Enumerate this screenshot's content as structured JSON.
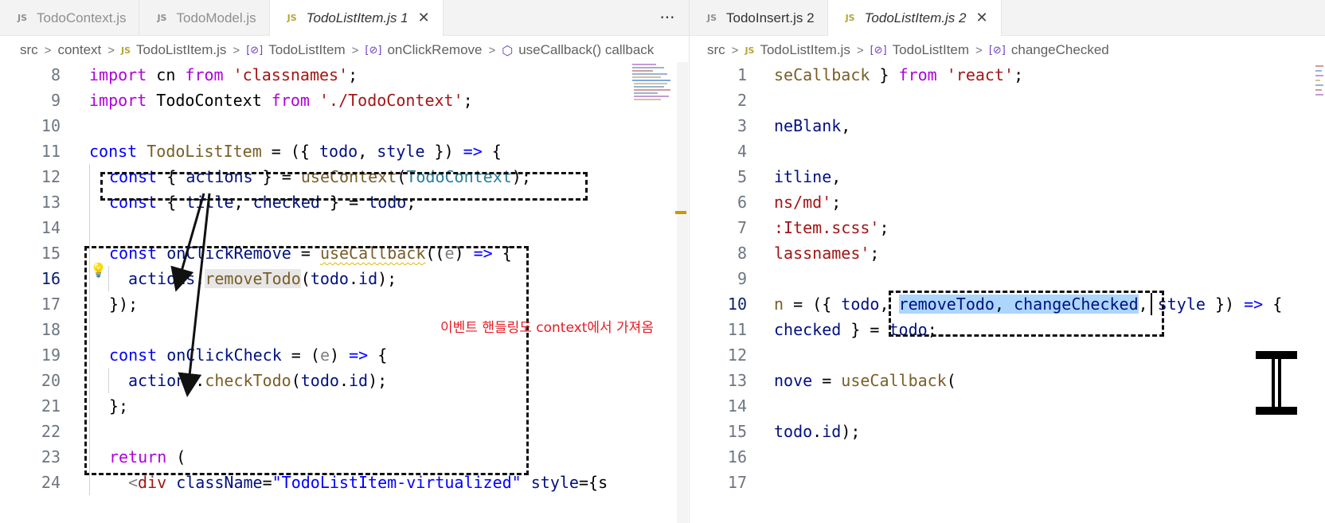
{
  "left_pane": {
    "tabs": [
      {
        "icon": "JS",
        "label": "TodoContext.js",
        "active": false
      },
      {
        "icon": "JS",
        "label": "TodoModel.js",
        "active": false
      },
      {
        "icon": "JS",
        "label": "TodoListItem.js 1",
        "active": true,
        "close": "✕"
      }
    ],
    "more": "···",
    "breadcrumb": [
      {
        "label": "src"
      },
      {
        "label": "context"
      },
      {
        "icon": "JS",
        "label": "TodoListItem.js"
      },
      {
        "icon": "[⊘]",
        "label": "TodoListItem"
      },
      {
        "icon": "[⊘]",
        "label": "onClickRemove"
      },
      {
        "icon": "⬡",
        "label": "useCallback() callback"
      }
    ],
    "line_numbers": [
      "8",
      "9",
      "10",
      "11",
      "12",
      "13",
      "14",
      "15",
      "16",
      "17",
      "18",
      "19",
      "20",
      "21",
      "22",
      "23",
      "24"
    ],
    "active_line": "16",
    "annotation": "이벤트 핸들링도 context에서 가져옴"
  },
  "right_pane": {
    "tabs": [
      {
        "icon": "JS",
        "label": "TodoInsert.js 2",
        "active": false
      },
      {
        "icon": "JS",
        "label": "TodoListItem.js 2",
        "active": true,
        "close": "✕"
      }
    ],
    "breadcrumb": [
      {
        "label": "src"
      },
      {
        "icon": "JS",
        "label": "TodoListItem.js"
      },
      {
        "icon": "[⊘]",
        "label": "TodoListItem"
      },
      {
        "icon": "[⊘]",
        "label": "changeChecked"
      }
    ],
    "line_numbers": [
      "1",
      "2",
      "3",
      "4",
      "5",
      "6",
      "7",
      "8",
      "9",
      "10",
      "11",
      "12",
      "13",
      "14",
      "15",
      "16",
      "17"
    ],
    "active_line": "10"
  },
  "colors": {
    "keyword": "#0000ff",
    "string": "#a31515",
    "variable": "#001080",
    "class": "#267f99",
    "function": "#795e26",
    "annotation": "#e51c23",
    "selection": "#add6ff"
  },
  "code": {
    "l8": {
      "t1": "import",
      "t2": " cn ",
      "t3": "from",
      "t4": " ",
      "t5": "'classnames'",
      "t6": ";"
    },
    "l9": {
      "t1": "import",
      "t2": " TodoContext ",
      "t3": "from",
      "t4": " ",
      "t5": "'./TodoContext'",
      "t6": ";"
    },
    "l11": {
      "t1": "const",
      "t2": " ",
      "t3": "TodoListItem",
      "t4": " = ({ ",
      "t5": "todo",
      "t6": ", ",
      "t7": "style",
      "t8": " }) ",
      "t9": "=>",
      "t10": " {"
    },
    "l12": {
      "t1": "const",
      "t2": " { ",
      "t3": "actions",
      "t4": " } = ",
      "t5": "useContext",
      "t6": "(",
      "t7": "TodoContext",
      "t8": ");"
    },
    "l13": {
      "t1": "const",
      "t2": " { ",
      "t3": "title",
      "t4": ", ",
      "t5": "checked",
      "t6": " } = ",
      "t7": "todo",
      "t8": ";"
    },
    "l15": {
      "t1": "const",
      "t2": " ",
      "t3": "onClickRemove",
      "t4": " = ",
      "t5": "useCallback",
      "t6": "((",
      "t7": "e",
      "t8": ") ",
      "t9": "=>",
      "t10": " {"
    },
    "l16": {
      "t1": "actions",
      "t2": ".",
      "t3": "removeTodo",
      "t4": "(",
      "t5": "todo",
      "t6": ".",
      "t7": "id",
      "t8": ");"
    },
    "l17": {
      "t1": "});"
    },
    "l19": {
      "t1": "const",
      "t2": " ",
      "t3": "onClickCheck",
      "t4": " = (",
      "t5": "e",
      "t6": ") ",
      "t7": "=>",
      "t8": " {"
    },
    "l20": {
      "t1": "actions",
      "t2": ".",
      "t3": "checkTodo",
      "t4": "(",
      "t5": "todo",
      "t6": ".",
      "t7": "id",
      "t8": ");"
    },
    "l21": {
      "t1": "};"
    },
    "l23": {
      "t1": "return",
      "t2": " ("
    },
    "l24": {
      "t1": "<",
      "t2": "div",
      "t3": " ",
      "t4": "className",
      "t5": "=",
      "t6": "\"TodoListItem-virtualized\"",
      "t7": " ",
      "t8": "style",
      "t9": "={s"
    },
    "r1": {
      "t1": "seCallback",
      "t2": " } ",
      "t3": "from",
      "t4": " ",
      "t5": "'react'",
      "t6": ";"
    },
    "r3": {
      "t1": "neBlank",
      "t2": ","
    },
    "r5": {
      "t1": "itline",
      "t2": ","
    },
    "r6": {
      "t1": "ns/md'",
      "t2": ";"
    },
    "r7": {
      "t1": ":Item.scss'",
      "t2": ";"
    },
    "r8": {
      "t1": "lassnames'",
      "t2": ";"
    },
    "r10": {
      "t1": "n",
      "t2": " = ({ ",
      "t3": "todo",
      "t4": ", ",
      "t5": "removeTodo",
      "t6": ", ",
      "t7": "changeChecked",
      "t8": ", ",
      "t9": "style",
      "t10": " }) ",
      "t11": "=>",
      "t12": " {"
    },
    "r11": {
      "t1": "checked",
      "t2": " } = ",
      "t3": "todo",
      "t4": ";"
    },
    "r13": {
      "t1": "nove",
      "t2": " = ",
      "t3": "useCallback",
      "t4": "("
    },
    "r15": {
      "t1": "todo",
      "t2": ".",
      "t3": "id",
      "t4": ");"
    }
  }
}
